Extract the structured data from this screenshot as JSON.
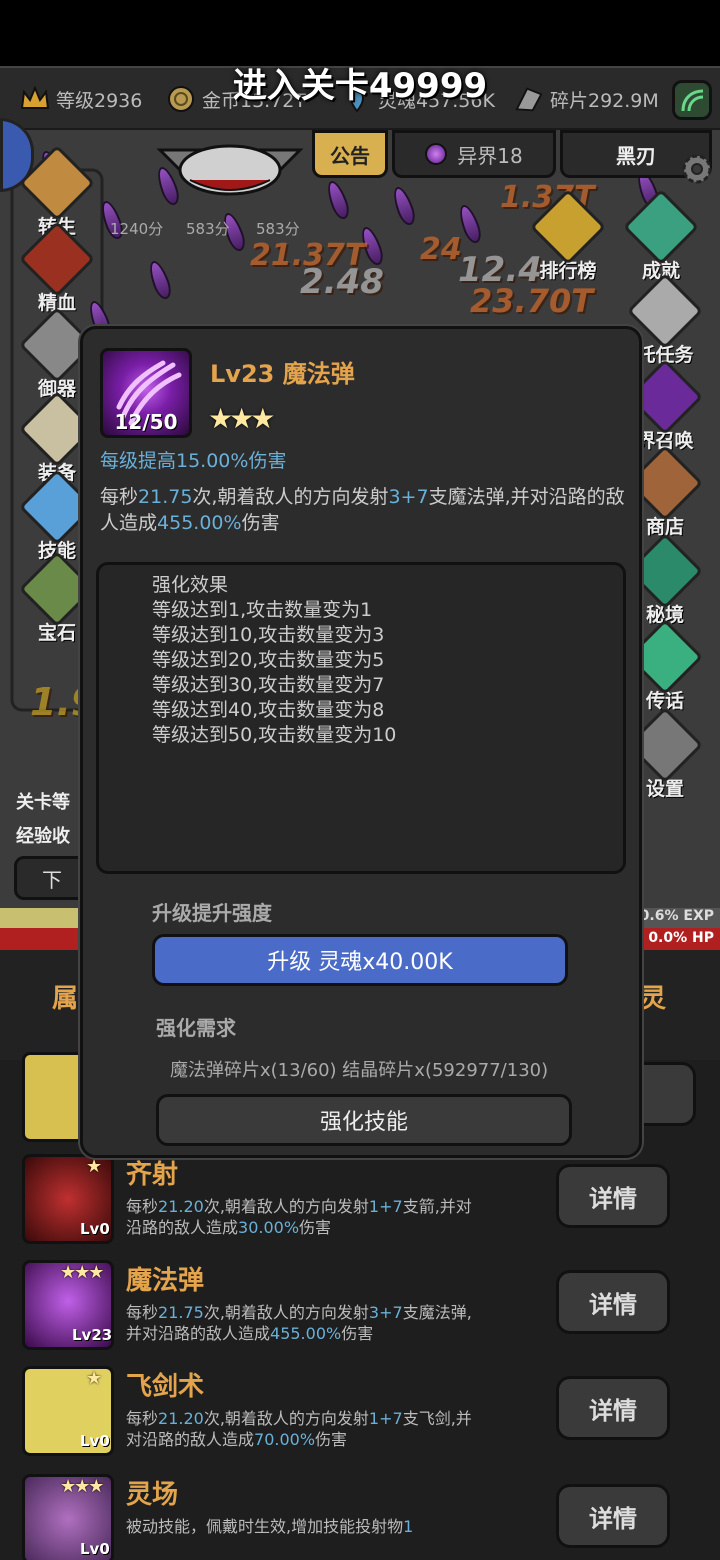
{
  "banner": "进入关卡49999",
  "resources": [
    {
      "icon": "crown-icon",
      "text": "等级2936"
    },
    {
      "icon": "coin-icon",
      "text": "金币13.72T"
    },
    {
      "icon": "soul-icon",
      "text": "灵魂457.56K"
    },
    {
      "icon": "shard-icon",
      "text": "碎片292.9M"
    }
  ],
  "top_tabs": {
    "notice": "公告",
    "realm": "异界18",
    "blade": "黑刃"
  },
  "left_menu": [
    "转生",
    "精血",
    "御器",
    "装备",
    "技能",
    "宝石"
  ],
  "right_menu": [
    "排行榜",
    "成就",
    "托任务",
    "界召唤",
    "商店",
    "秘境",
    "传话",
    "设置"
  ],
  "timers": [
    "1240分",
    "583分",
    "583分"
  ],
  "floating_damage": [
    "21.37T",
    "2.48",
    "12.4",
    "23.70T",
    "24",
    "1.37T",
    "1.9"
  ],
  "stage_info": {
    "level_label": "关卡等",
    "exp_label": "经验收",
    "next": "下"
  },
  "bars": {
    "exp": "0.6% EXP",
    "hp": "0.0% HP"
  },
  "bottom_tabs": {
    "left": "属",
    "right": "灵"
  },
  "modal": {
    "title": "Lv23 魔法弹",
    "count": "12/50",
    "stars": "★★★",
    "per_level": "每级提高15.00%伤害",
    "desc_a": "每秒",
    "desc_rate": "21.75",
    "desc_b": "次,朝着敌人的方向发射",
    "desc_count": "3+7",
    "desc_c": "支魔法弹,并对沿路的敌人造成",
    "desc_dmg": "455.00%",
    "desc_d": "伤害",
    "effect_lines": [
      "强化效果",
      "等级达到1,攻击数量变为1",
      "等级达到10,攻击数量变为3",
      "等级达到20,攻击数量变为5",
      "等级达到30,攻击数量变为7",
      "等级达到40,攻击数量变为8",
      "等级达到50,攻击数量变为10"
    ],
    "upgrade_label": "升级提升强度",
    "upgrade_button": "升级 灵魂x40.00K",
    "require_label": "强化需求",
    "require_text": "魔法弹碎片x(13/60) 结晶碎片x(592977/130)",
    "enhance_button": "强化技能"
  },
  "skills": [
    {
      "name": "齐射",
      "lv": "Lv0",
      "stars": "★",
      "d1": "每秒",
      "rate": "21.20",
      "d2": "次,朝着敌人的方向发射",
      "cnt": "1+7",
      "d3": "支箭,并对沿路的敌人造成",
      "dmg": "30.00%",
      "d4": "伤害",
      "button": "详情"
    },
    {
      "name": "魔法弹",
      "lv": "Lv23",
      "stars": "★★★",
      "d1": "每秒",
      "rate": "21.75",
      "d2": "次,朝着敌人的方向发射",
      "cnt": "3+7",
      "d3": "支魔法弹,并对沿路的敌人造成",
      "dmg": "455.00%",
      "d4": "伤害",
      "button": "详情"
    },
    {
      "name": "飞剑术",
      "lv": "Lv0",
      "stars": "★",
      "d1": "每秒",
      "rate": "21.20",
      "d2": "次,朝着敌人的方向发射",
      "cnt": "1+7",
      "d3": "支飞剑,并对沿路的敌人造成",
      "dmg": "70.00%",
      "d4": "伤害",
      "button": "详情"
    },
    {
      "name": "灵场",
      "lv": "Lv0",
      "stars": "★★★",
      "d1": "被动技能，佩戴时生效,增加技能投射物",
      "rate": "",
      "d2": "",
      "cnt": "1",
      "d3": "",
      "dmg": "",
      "d4": "",
      "button": "详情"
    }
  ],
  "colors": {
    "accent_gold": "#e4a44c",
    "highlight_blue": "#6ab0d8",
    "upgrade_blue": "#4a6cc8",
    "hp_red": "#b02020"
  }
}
